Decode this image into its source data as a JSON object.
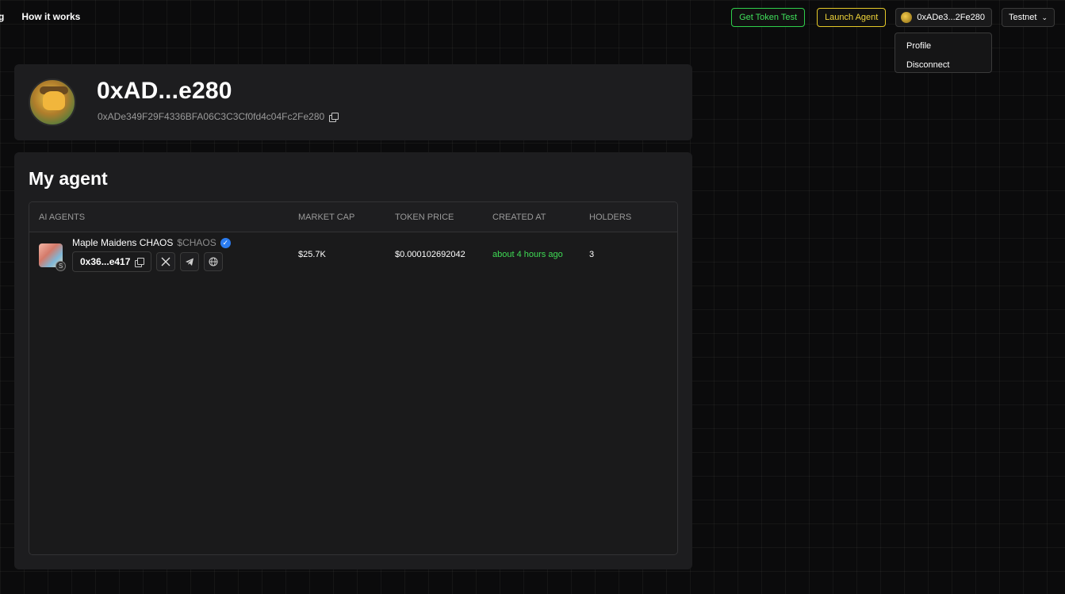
{
  "nav": {
    "items": [
      {
        "label": "g"
      },
      {
        "label": "How it works"
      }
    ],
    "get_token_label": "Get Token Test",
    "launch_agent_label": "Launch Agent",
    "wallet_label": "0xADe3...2Fe280",
    "network_label": "Testnet"
  },
  "wallet_menu": {
    "items": [
      "Profile",
      "Disconnect"
    ]
  },
  "profile": {
    "short_address": "0xAD...e280",
    "full_address": "0xADe349F29F4336BFA06C3C3Cf0fd4c04Fc2Fe280"
  },
  "agents_section": {
    "title": "My agent",
    "columns": [
      "AI AGENTS",
      "MARKET CAP",
      "TOKEN PRICE",
      "CREATED AT",
      "HOLDERS"
    ],
    "rows": [
      {
        "name": "Maple Maidens CHAOS",
        "ticker": "$CHAOS",
        "contract_short": "0x36...e417",
        "market_cap": "$25.7K",
        "token_price": "$0.000102692042",
        "created_at": "about 4 hours ago",
        "holders": "3"
      }
    ]
  },
  "colors": {
    "accent_green": "#40e05b",
    "accent_yellow": "#f1d53a",
    "verified_blue": "#2b7cf0"
  }
}
